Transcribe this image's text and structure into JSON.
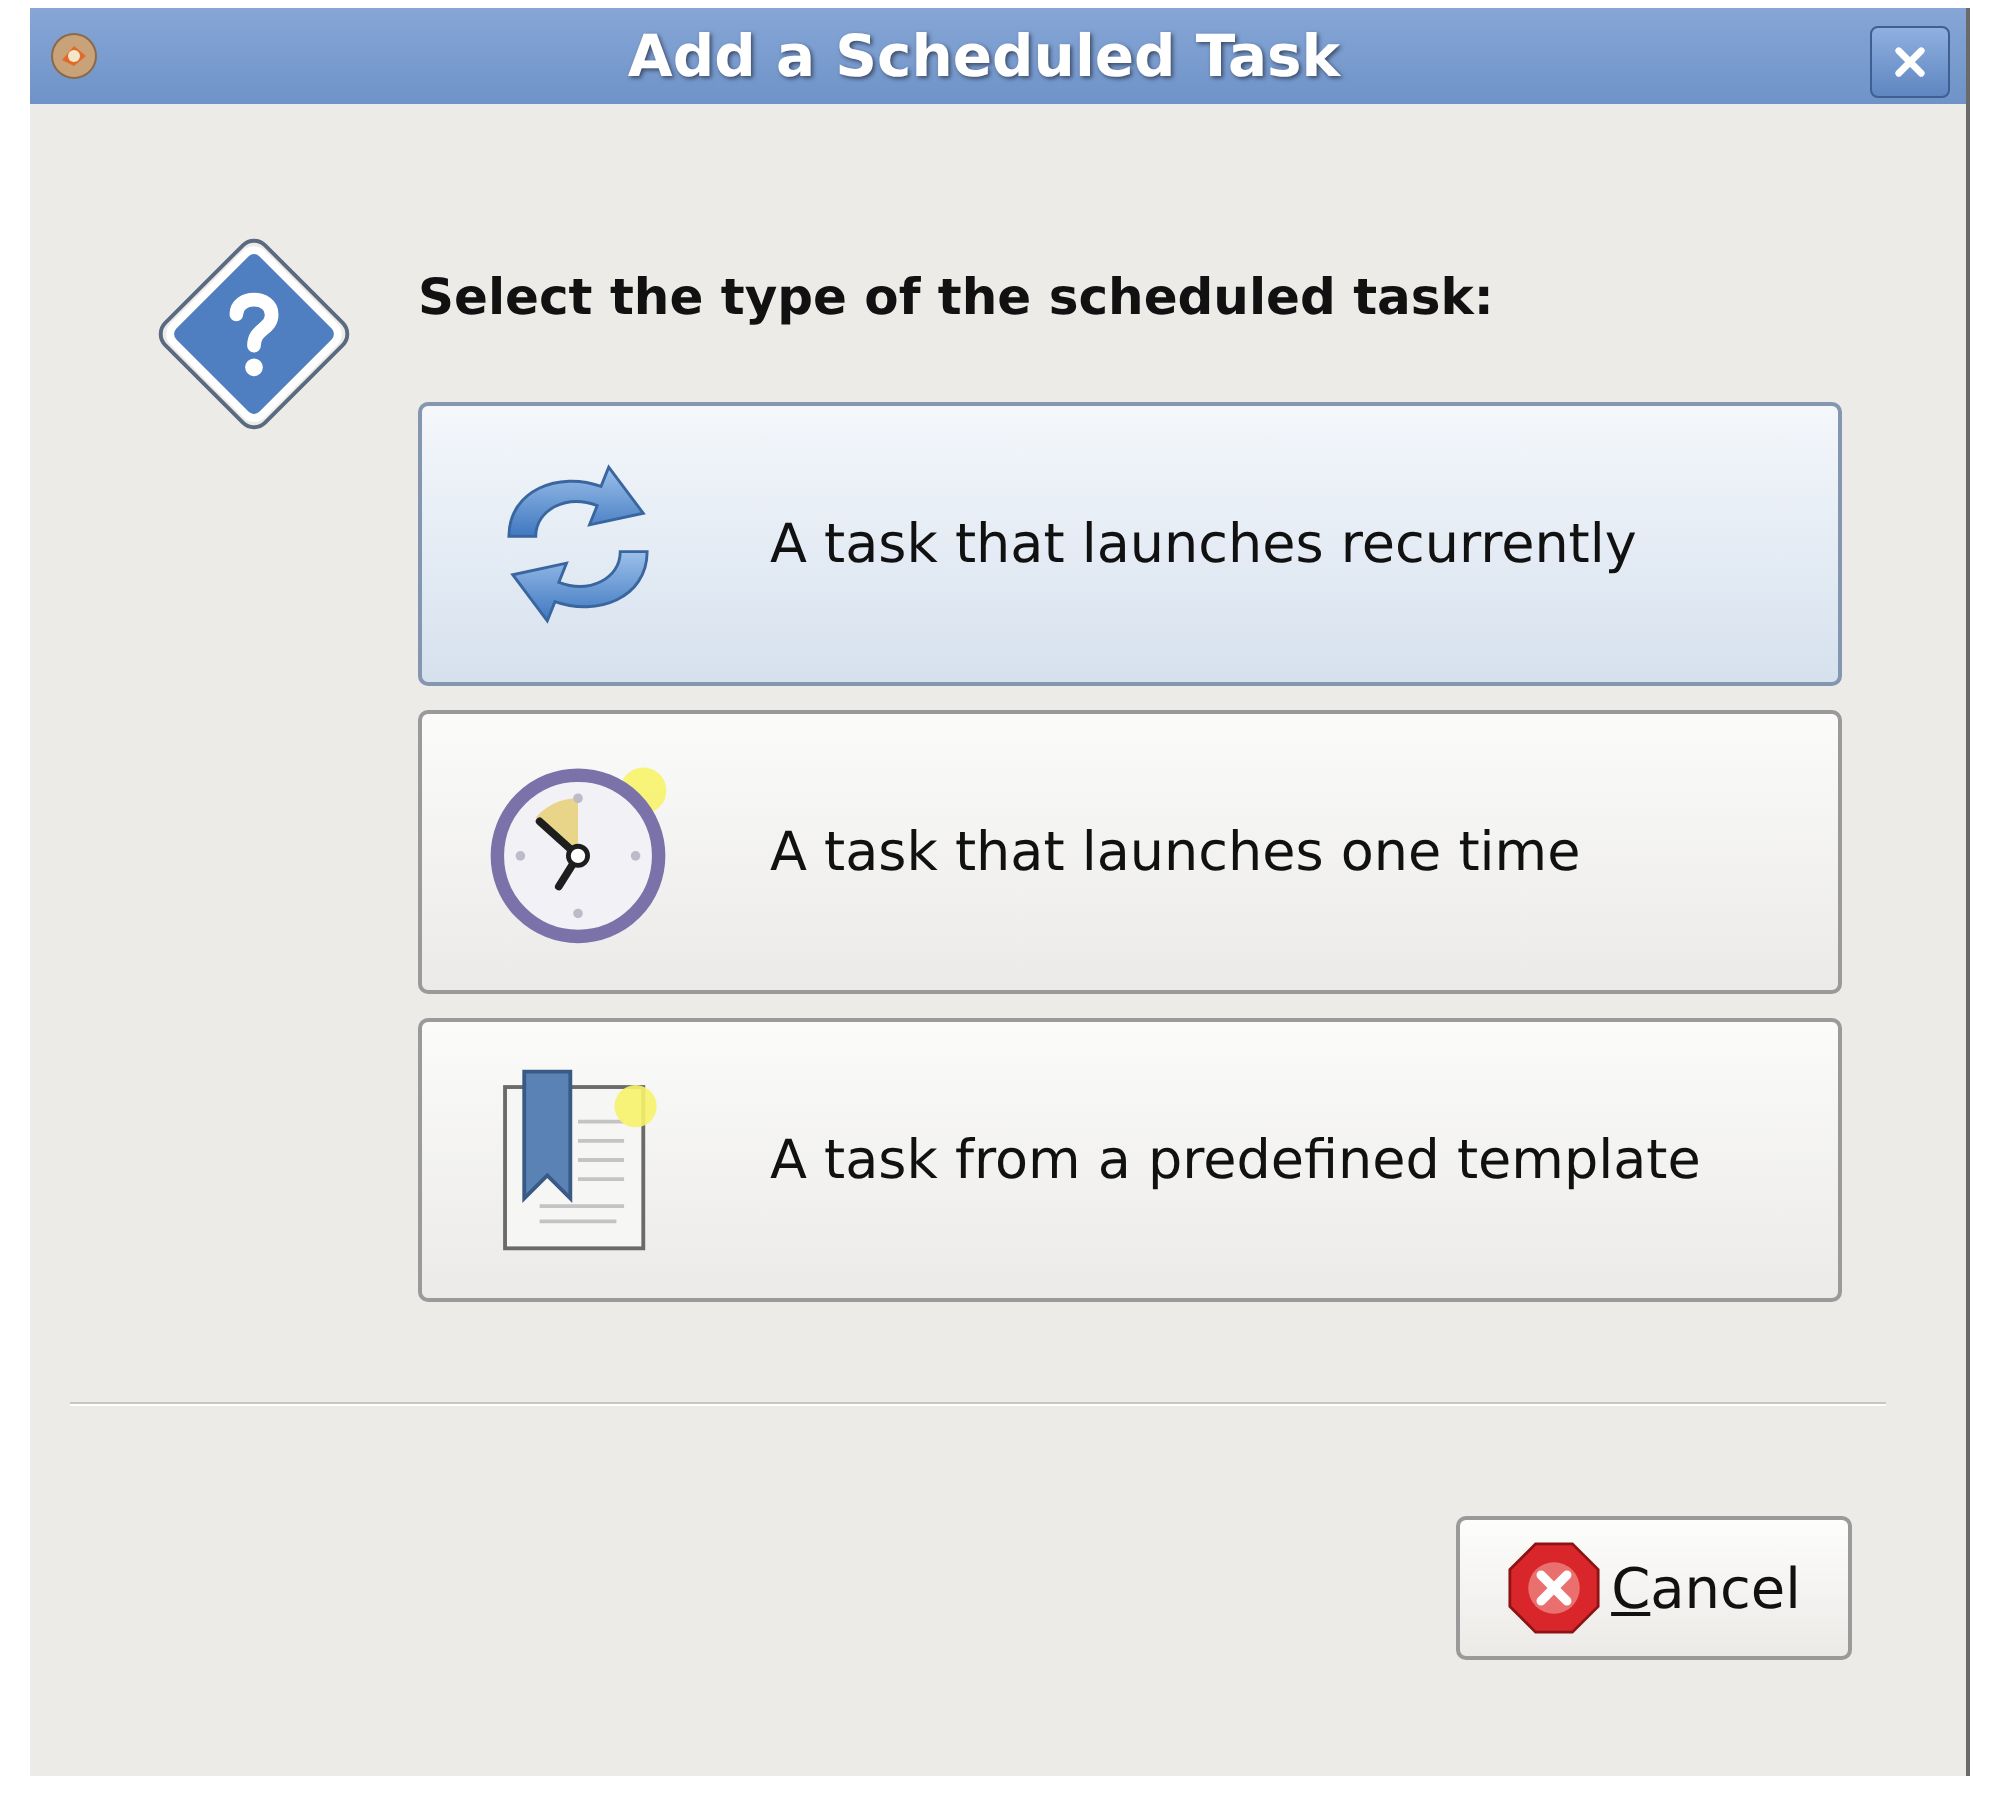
{
  "window": {
    "title": "Add a Scheduled Task"
  },
  "heading": "Select the type of the scheduled task:",
  "options": [
    {
      "kind": "recurrent",
      "label": "A task that launches recurrently",
      "selected": true
    },
    {
      "kind": "once",
      "label": "A task that launches one time",
      "selected": false
    },
    {
      "kind": "template",
      "label": "A task from a predefined template",
      "selected": false
    }
  ],
  "buttons": [
    {
      "kind": "cancel",
      "label": "Cancel",
      "mnemonic_underlined": true
    }
  ]
}
